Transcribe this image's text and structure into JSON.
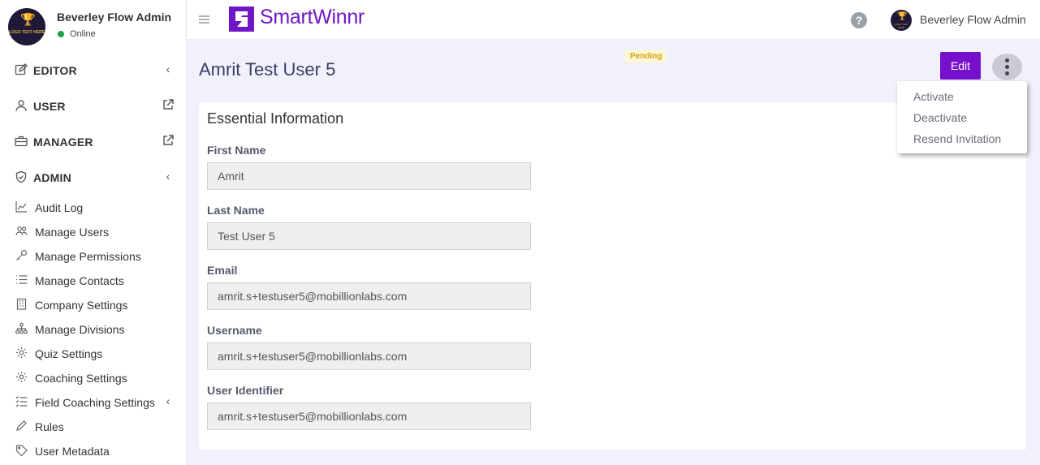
{
  "profile": {
    "name": "Beverley Flow Admin",
    "status": "Online",
    "logo_text": "LOGO TEXT HERE"
  },
  "sidebar": {
    "sections": [
      {
        "label": "EDITOR",
        "icon": "edit-icon",
        "indicator": "chevron-left-icon"
      },
      {
        "label": "USER",
        "icon": "user-icon",
        "indicator": "external-link-icon"
      },
      {
        "label": "MANAGER",
        "icon": "briefcase-icon",
        "indicator": "external-link-icon"
      },
      {
        "label": "ADMIN",
        "icon": "shield-icon",
        "indicator": "chevron-left-icon"
      }
    ],
    "admin_items": [
      {
        "label": "Audit Log",
        "icon": "chart-line-icon"
      },
      {
        "label": "Manage Users",
        "icon": "users-icon"
      },
      {
        "label": "Manage Permissions",
        "icon": "key-icon"
      },
      {
        "label": "Manage Contacts",
        "icon": "list-icon"
      },
      {
        "label": "Company Settings",
        "icon": "building-icon"
      },
      {
        "label": "Manage Divisions",
        "icon": "hierarchy-icon"
      },
      {
        "label": "Quiz Settings",
        "icon": "gear-icon"
      },
      {
        "label": "Coaching Settings",
        "icon": "gear-icon"
      },
      {
        "label": "Field Coaching Settings",
        "icon": "list-check-icon",
        "indicator": "chevron-left-icon"
      },
      {
        "label": "Rules",
        "icon": "pen-icon"
      },
      {
        "label": "User Metadata",
        "icon": "tag-icon"
      }
    ]
  },
  "header": {
    "brand": "SmartWinnr",
    "user_name": "Beverley Flow Admin",
    "accent": "#6f16c6"
  },
  "page": {
    "title": "Amrit Test User 5",
    "status_badge": "Pending",
    "edit_label": "Edit",
    "menu": [
      "Activate",
      "Deactivate",
      "Resend Invitation"
    ]
  },
  "card": {
    "title": "Essential Information",
    "fields": [
      {
        "label": "First Name",
        "value": "Amrit"
      },
      {
        "label": "Last Name",
        "value": "Test User 5"
      },
      {
        "label": "Email",
        "value": "amrit.s+testuser5@mobillionlabs.com"
      },
      {
        "label": "Username",
        "value": "amrit.s+testuser5@mobillionlabs.com"
      },
      {
        "label": "User Identifier",
        "value": "amrit.s+testuser5@mobillionlabs.com"
      }
    ]
  }
}
